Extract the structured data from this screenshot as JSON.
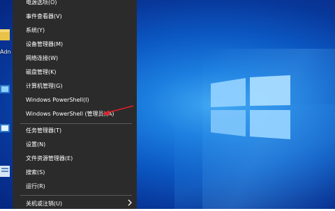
{
  "desktop": {
    "icon_labels": [
      "Adn",
      "",
      "",
      ""
    ],
    "colors": {
      "background": "#0b57c2",
      "logo": "#9fd8ff"
    },
    "logo_icon": "windows-logo-icon"
  },
  "menu": {
    "background": "#2b2b2b",
    "items": [
      {
        "label": "电源选项(O)"
      },
      {
        "label": "事件查看器(V)"
      },
      {
        "label": "系统(Y)"
      },
      {
        "label": "设备管理器(M)"
      },
      {
        "label": "网络连接(W)"
      },
      {
        "label": "磁盘管理(K)"
      },
      {
        "label": "计算机管理(G)"
      },
      {
        "label": "Windows PowerShell(I)"
      },
      {
        "label": "Windows PowerShell (管理员)(A)"
      },
      {
        "label": "任务管理器(T)"
      },
      {
        "label": "设置(N)"
      },
      {
        "label": "文件资源管理器(E)"
      },
      {
        "label": "搜索(S)"
      },
      {
        "label": "运行(R)"
      },
      {
        "label": "关机或注销(U)",
        "has_submenu": true
      }
    ]
  },
  "annotation": {
    "type": "red-arrow",
    "color": "#e0202a",
    "points_to": "Windows PowerShell (管理员)(A)"
  }
}
